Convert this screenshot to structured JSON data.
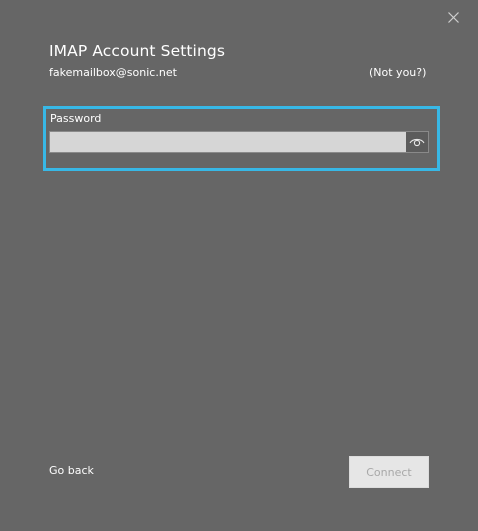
{
  "dialog": {
    "title": "IMAP Account Settings",
    "account_email": "fakemailbox@sonic.net",
    "not_you_link": "(Not you?)",
    "close_icon": "close-icon"
  },
  "password": {
    "label": "Password",
    "value": "",
    "placeholder": "",
    "reveal_icon": "eye-icon"
  },
  "footer": {
    "go_back_label": "Go back",
    "connect_label": "Connect"
  },
  "colors": {
    "background": "#666666",
    "highlight": "#38b8e6",
    "field_background": "#d6d6d6",
    "connect_disabled_bg": "#e6e6e6",
    "connect_disabled_text": "#a8a8a8"
  }
}
